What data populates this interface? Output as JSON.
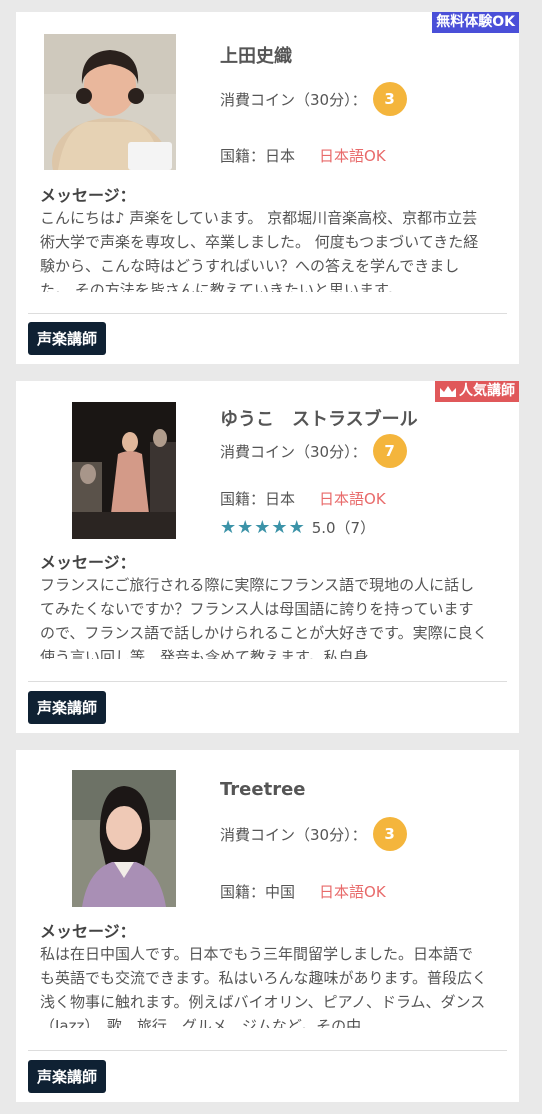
{
  "teachers": [
    {
      "name": "上田史織",
      "badge": "無料体験OK",
      "coin_label": "消費コイン（30分）：",
      "coin": "3",
      "nationality": "国籍：日本",
      "japanese_ok": "日本語OK",
      "message_label": "メッセージ：",
      "message": "こんにちは♪ 声楽をしています。 京都堀川音楽高校、京都市立芸術大学で声楽を専攻し、卒業しました。 何度もつまづいてきた経験から、こんな時はどうすればいい？への答えを学んできました。 その方法を皆さんに教えていきたいと思います。",
      "tag": "声楽講師"
    },
    {
      "name": "ゆうこ　ストラスブール",
      "badge": "人気講師",
      "badge_icon": "crown-icon",
      "coin_label": "消費コイン（30分）：",
      "coin": "7",
      "nationality": "国籍：日本",
      "japanese_ok": "日本語OK",
      "rating": "5.0（7）",
      "stars": 5,
      "message_label": "メッセージ：",
      "message": "フランスにご旅行される際に実際にフランス語で現地の人に話してみたくないですか？フランス人は母国語に誇りを持っていますので、フランス語で話しかけられることが大好きです。実際に良く使う言い回し等、発音も含めて教えます。私自身",
      "tag": "声楽講師"
    },
    {
      "name": "Treetree",
      "coin_label": "消費コイン（30分）：",
      "coin": "3",
      "nationality": "国籍：中国",
      "japanese_ok": "日本語OK",
      "message_label": "メッセージ：",
      "message": "私は在日中国人です。日本でもう三年間留学しました。日本語でも英語でも交流できます。私はいろんな趣味があります。普段広く浅く物事に触れます。例えばバイオリン、ピアノ、ドラム、ダンス（Jazz）、歌、旅行、グルメ、ジムなど。その中",
      "tag": "声楽講師"
    }
  ],
  "colors": {
    "coin": "#f4b53c",
    "free_badge": "#4a4fd8",
    "popular_badge": "#e0585a",
    "japanese_ok": "#e86a6a",
    "star": "#3c93a8",
    "tag": "#0f2133"
  }
}
